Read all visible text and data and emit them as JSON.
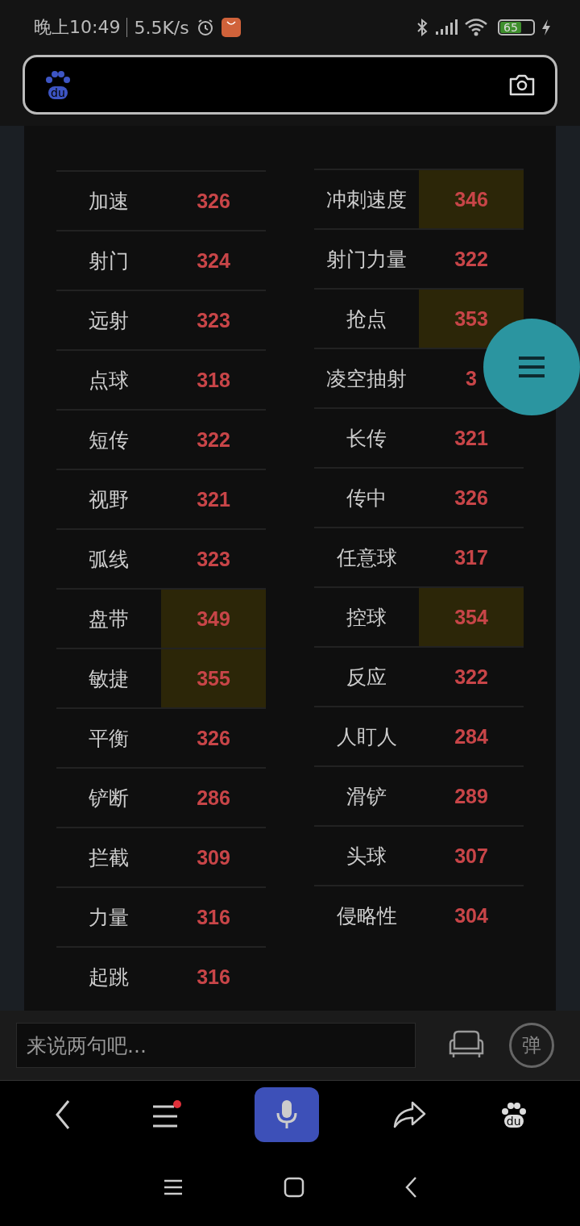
{
  "status_bar": {
    "time": "晚上10:49",
    "speed": "5.5K/s",
    "battery": "65"
  },
  "search_bar": {
    "logo": "du"
  },
  "left_stats": [
    {
      "label": "加速",
      "value": "326",
      "highlighted": false
    },
    {
      "label": "射门",
      "value": "324",
      "highlighted": false
    },
    {
      "label": "远射",
      "value": "323",
      "highlighted": false
    },
    {
      "label": "点球",
      "value": "318",
      "highlighted": false
    },
    {
      "label": "短传",
      "value": "322",
      "highlighted": false
    },
    {
      "label": "视野",
      "value": "321",
      "highlighted": false
    },
    {
      "label": "弧线",
      "value": "323",
      "highlighted": false
    },
    {
      "label": "盘带",
      "value": "349",
      "highlighted": true
    },
    {
      "label": "敏捷",
      "value": "355",
      "highlighted": true
    },
    {
      "label": "平衡",
      "value": "326",
      "highlighted": false
    },
    {
      "label": "铲断",
      "value": "286",
      "highlighted": false
    },
    {
      "label": "拦截",
      "value": "309",
      "highlighted": false
    },
    {
      "label": "力量",
      "value": "316",
      "highlighted": false
    },
    {
      "label": "起跳",
      "value": "316",
      "highlighted": false
    }
  ],
  "right_stats": [
    {
      "label": "冲刺速度",
      "value": "346",
      "highlighted": true
    },
    {
      "label": "射门力量",
      "value": "322",
      "highlighted": false
    },
    {
      "label": "抢点",
      "value": "353",
      "highlighted": true
    },
    {
      "label": "凌空抽射",
      "value": "3",
      "highlighted": false
    },
    {
      "label": "长传",
      "value": "321",
      "highlighted": false
    },
    {
      "label": "传中",
      "value": "326",
      "highlighted": false
    },
    {
      "label": "任意球",
      "value": "317",
      "highlighted": false
    },
    {
      "label": "控球",
      "value": "354",
      "highlighted": true
    },
    {
      "label": "反应",
      "value": "322",
      "highlighted": false
    },
    {
      "label": "人盯人",
      "value": "284",
      "highlighted": false
    },
    {
      "label": "滑铲",
      "value": "289",
      "highlighted": false
    },
    {
      "label": "头球",
      "value": "307",
      "highlighted": false
    },
    {
      "label": "侵略性",
      "value": "304",
      "highlighted": false
    }
  ],
  "comment_bar": {
    "placeholder": "来说两句吧...",
    "danmaku": "弹"
  },
  "bottom_nav": {
    "menu_badge": true,
    "logo": "du"
  }
}
